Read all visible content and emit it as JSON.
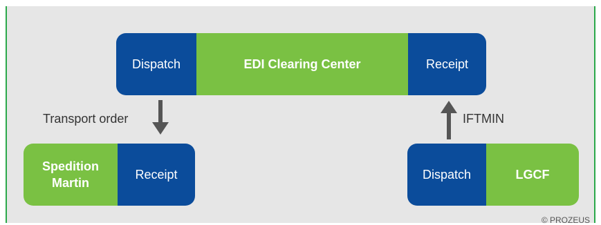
{
  "top": {
    "dispatch": "Dispatch",
    "center": "EDI Clearing Center",
    "receipt": "Receipt"
  },
  "left": {
    "name_line1": "Spedition",
    "name_line2": "Martin",
    "receipt": "Receipt"
  },
  "right": {
    "dispatch": "Dispatch",
    "name": "LGCF"
  },
  "edges": {
    "transport_order": "Transport order",
    "iftmin": "IFTMIN"
  },
  "copyright": "© PROZEUS",
  "colors": {
    "blue": "#0b4c9b",
    "green": "#7ac143",
    "arrow": "#555555",
    "frame": "#2aa84a"
  }
}
